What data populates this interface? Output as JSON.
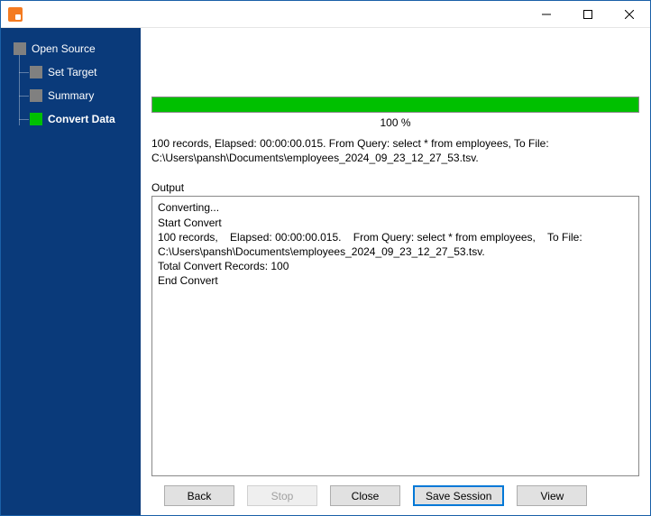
{
  "sidebar": {
    "root": {
      "label": "Open Source"
    },
    "items": [
      {
        "label": "Set Target"
      },
      {
        "label": "Summary"
      },
      {
        "label": "Convert Data"
      }
    ]
  },
  "progress": {
    "percent_label": "100 %"
  },
  "summary_text": "100 records,    Elapsed: 00:00:00.015.    From Query: select * from employees,    To File: C:\\Users\\pansh\\Documents\\employees_2024_09_23_12_27_53.tsv.",
  "output": {
    "label": "Output",
    "text": "Converting...\nStart Convert\n100 records,    Elapsed: 00:00:00.015.    From Query: select * from employees,    To File: C:\\Users\\pansh\\Documents\\employees_2024_09_23_12_27_53.tsv.\nTotal Convert Records: 100\nEnd Convert"
  },
  "buttons": {
    "back": "Back",
    "stop": "Stop",
    "close": "Close",
    "save_session": "Save Session",
    "view": "View"
  }
}
